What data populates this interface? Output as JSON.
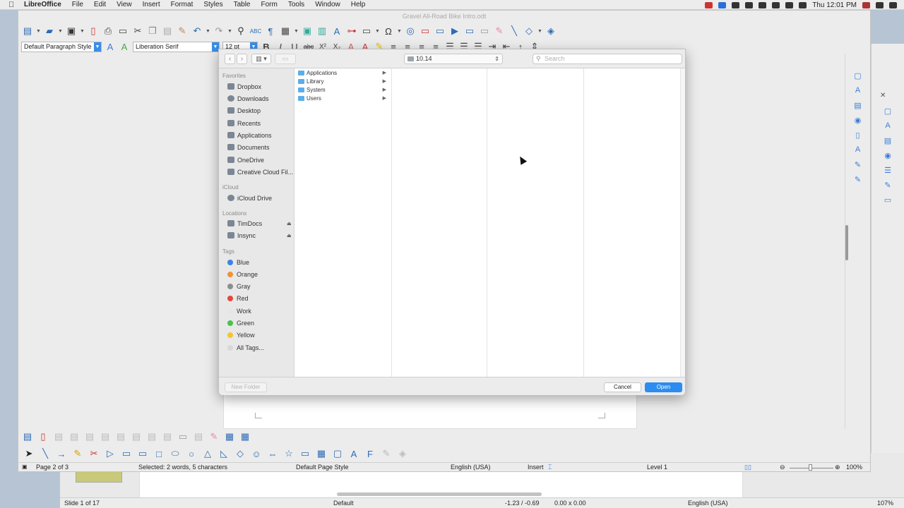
{
  "menubar": {
    "app": "LibreOffice",
    "items": [
      "File",
      "Edit",
      "View",
      "Insert",
      "Format",
      "Styles",
      "Table",
      "Form",
      "Tools",
      "Window",
      "Help"
    ],
    "clock": "Thu 12:01 PM"
  },
  "window": {
    "title": "Gravel All-Road Bike Intro.odt"
  },
  "formatting": {
    "paragraph_style": "Default Paragraph Style",
    "font_name": "Liberation Serif",
    "font_size": "12 pt"
  },
  "dialog": {
    "path": "10.14",
    "search_placeholder": "Search",
    "sections": {
      "favorites": "Favorites",
      "icloud": "iCloud",
      "locations": "Locations",
      "tags": "Tags"
    },
    "favorites": [
      "Dropbox",
      "Downloads",
      "Desktop",
      "Recents",
      "Applications",
      "Documents",
      "OneDrive",
      "Creative Cloud Fil..."
    ],
    "icloud_items": [
      "iCloud Drive"
    ],
    "locations": [
      "TimDocs",
      "Insync"
    ],
    "tags": [
      {
        "label": "Blue",
        "color": "#3c83e8"
      },
      {
        "label": "Orange",
        "color": "#f0923a"
      },
      {
        "label": "Gray",
        "color": "#8e8e8e"
      },
      {
        "label": "Red",
        "color": "#e5463f"
      },
      {
        "label": "Work",
        "color": "#e6e6e6"
      },
      {
        "label": "Green",
        "color": "#4ac24a"
      },
      {
        "label": "Yellow",
        "color": "#f4c531"
      },
      {
        "label": "All Tags...",
        "color": "#d8d8d8"
      }
    ],
    "folders": [
      "Applications",
      "Library",
      "System",
      "Users"
    ],
    "buttons": {
      "new_folder": "New Folder",
      "cancel": "Cancel",
      "open": "Open"
    }
  },
  "status": {
    "page": "Page 2 of 3",
    "selection": "Selected: 2 words, 5 characters",
    "page_style": "Default Page Style",
    "language": "English (USA)",
    "mode": "Insert",
    "level": "Level 1",
    "zoom": "100%"
  },
  "bg_status": {
    "slide": "Slide 1 of 17",
    "layout": "Default",
    "position": "-1.23 / -0.69",
    "size": "0.00 x 0.00",
    "language": "English (USA)",
    "zoom": "107%"
  }
}
